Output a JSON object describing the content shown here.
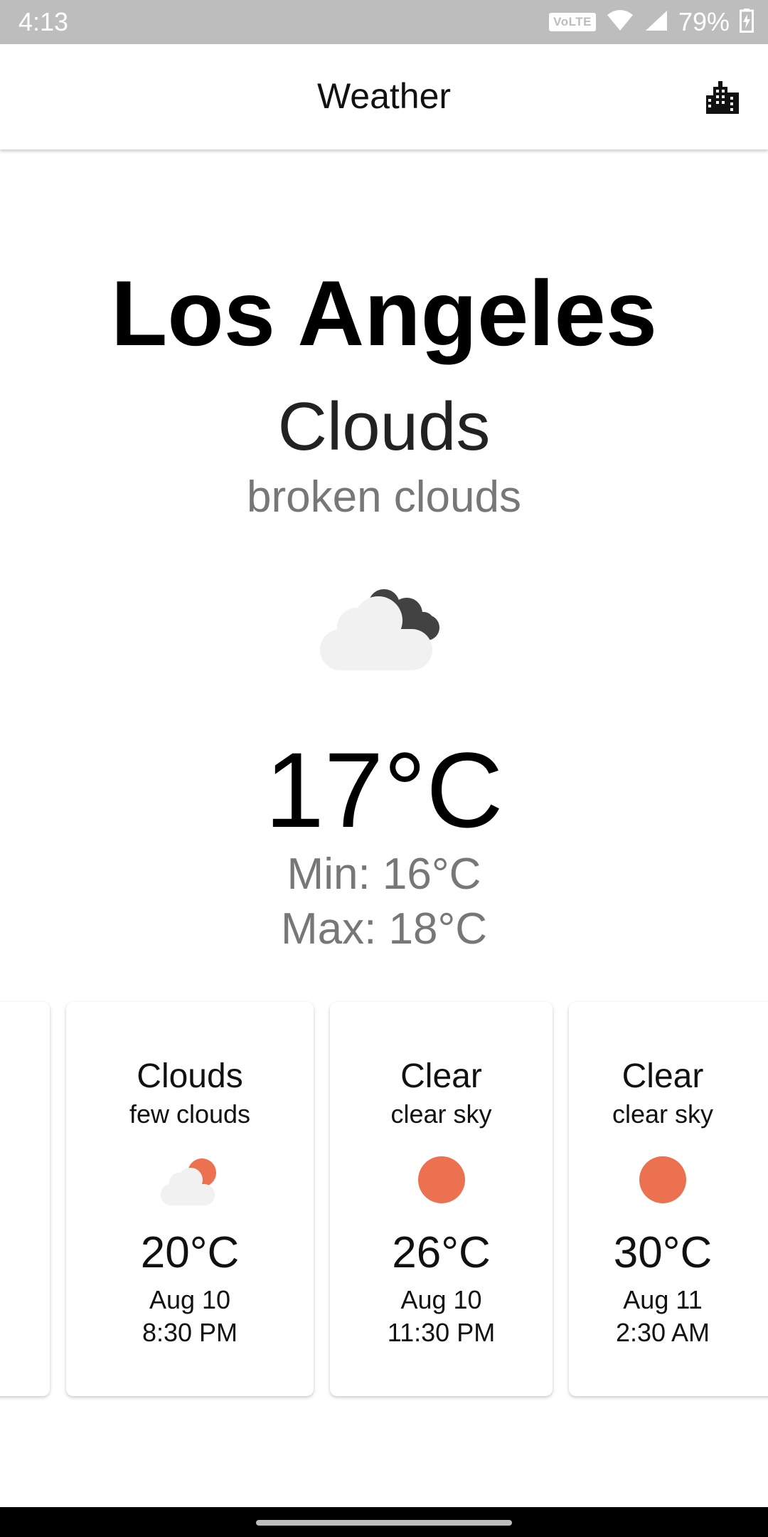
{
  "status_bar": {
    "time": "4:13",
    "network_badge": "VoLTE",
    "battery_percent": "79%"
  },
  "app_bar": {
    "title": "Weather",
    "city_icon": "city-buildings-icon"
  },
  "current": {
    "city": "Los Angeles",
    "condition": "Clouds",
    "description": "broken clouds",
    "icon": "broken-clouds-icon",
    "temperature": "17°C",
    "min": "Min: 16°C",
    "max": "Max: 18°C"
  },
  "forecast": [
    {
      "condition": "Clouds",
      "description": "few clouds",
      "icon": "few-clouds-icon",
      "temperature": "20°C",
      "date": "Aug 10",
      "time": "8:30 PM"
    },
    {
      "condition": "Clear",
      "description": "clear sky",
      "icon": "clear-sky-icon",
      "temperature": "26°C",
      "date": "Aug 10",
      "time": "11:30 PM"
    },
    {
      "condition": "Clear",
      "description": "clear sky",
      "icon": "clear-sky-icon",
      "temperature": "30°C",
      "date": "Aug 11",
      "time": "2:30 AM"
    }
  ],
  "colors": {
    "status_bar": "#bdbdbd",
    "sun": "#ec7150",
    "cloud_light": "#f1f1f1",
    "cloud_dark": "#424242",
    "secondary_text": "#777777"
  }
}
